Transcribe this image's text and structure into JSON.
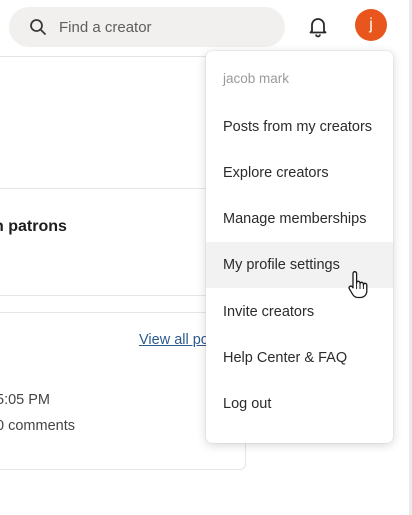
{
  "header": {
    "search_placeholder": "Find a creator",
    "avatar_initial": "j"
  },
  "background": {
    "card_heading_fragment": "n patrons",
    "view_all_fragment": "View all po",
    "time_fragment": "5:05 PM",
    "comments_fragment": "0 comments"
  },
  "menu": {
    "user_name": "jacob mark",
    "items": [
      {
        "label": "Posts from my creators"
      },
      {
        "label": "Explore creators"
      },
      {
        "label": "Manage memberships"
      },
      {
        "label": "My profile settings"
      },
      {
        "label": "Invite creators"
      },
      {
        "label": "Help Center & FAQ"
      },
      {
        "label": "Log out"
      }
    ],
    "hovered_item": "My profile settings"
  },
  "colors": {
    "avatar_bg": "#e8561d",
    "link": "#2d5a8c",
    "menu_hover": "#f2f2f2"
  },
  "icons": [
    "search-icon",
    "bell-icon",
    "pointer-hand-icon"
  ]
}
